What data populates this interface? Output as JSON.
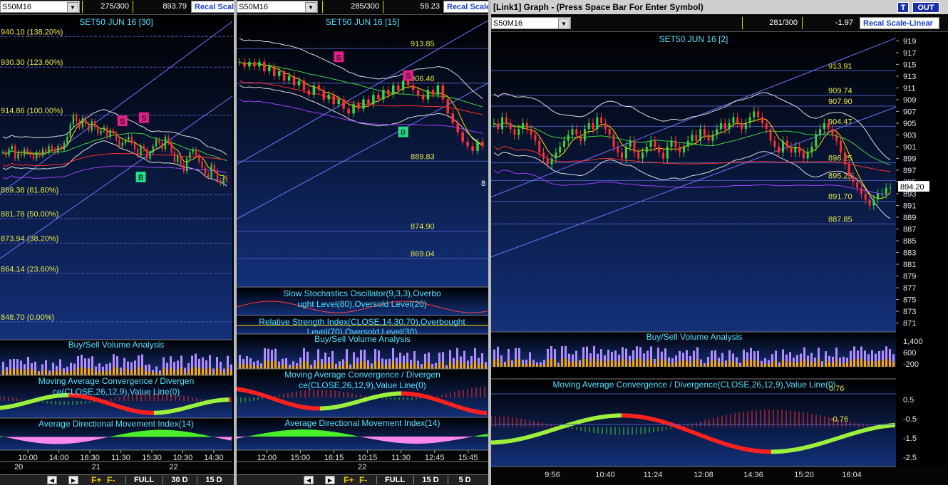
{
  "panels": [
    {
      "symbol": "S50M16",
      "count": "275/300",
      "value": "893.79",
      "recal": "Recal Scale",
      "bottom_buttons": [
        "FULL",
        "30 D",
        "15 D"
      ],
      "f_icons": [
        "F+",
        "F-"
      ]
    },
    {
      "symbol": "S50M16",
      "count": "285/300",
      "value": "59.23",
      "recal": "Recal Scale",
      "bottom_buttons": [
        "FULL",
        "15 D",
        "5 D"
      ],
      "f_icons": [
        "F+",
        "F-"
      ]
    },
    {
      "title": "[Link1] Graph  - (Press Space Bar For Enter Symbol)",
      "t_button": "T",
      "out_button": "OUT",
      "symbol": "S50M16",
      "count": "281/300",
      "value": "-1.97",
      "recal": "Recal Scale-Linear"
    }
  ],
  "colors": {
    "background": "#000000",
    "gridline": "#2d3a86",
    "label": "#e8e84a",
    "title": "#4fe0ff",
    "buy": "#ffa500",
    "sell": "#b38cff",
    "macd_pos": "#9cf03c",
    "macd_neg": "#ff2020",
    "adx_fill": "#ff88ee"
  },
  "chart_data": [
    {
      "type": "candlestick",
      "title": "SET50 JUN 16  [30]",
      "ylim": [
        843,
        947
      ],
      "fib_levels": [
        {
          "price": 940.1,
          "label": "940.10 (138.20%)"
        },
        {
          "price": 930.3,
          "label": "930.30 (123.60%)"
        },
        {
          "price": 914.86,
          "label": "914.86 (100.00%)"
        },
        {
          "price": 889.38,
          "label": "889.38 (61.80%)"
        },
        {
          "price": 881.78,
          "label": "881.78 (50.00%)"
        },
        {
          "price": 873.94,
          "label": "873.94 (38.20%)"
        },
        {
          "price": 864.14,
          "label": "864.14 (23.60%)"
        },
        {
          "price": 848.7,
          "label": "848.70 (0.00%)"
        }
      ],
      "close": [
        903,
        902,
        904,
        905,
        901,
        903,
        902,
        904,
        903,
        902,
        901,
        903,
        902,
        904,
        903,
        905,
        904,
        903,
        905,
        904,
        906,
        908,
        912,
        915,
        913,
        911,
        914,
        912,
        910,
        913,
        911,
        909,
        910,
        911,
        908,
        910,
        909,
        907,
        905,
        906,
        907,
        908,
        906,
        904,
        902,
        905,
        904,
        901,
        903,
        905,
        907,
        906,
        904,
        908,
        906,
        903,
        900,
        902,
        899,
        897,
        901,
        903,
        904,
        902,
        900,
        898,
        896,
        895,
        899,
        897,
        894,
        893,
        895,
        894
      ],
      "signals": [
        {
          "label": "S",
          "index": 39,
          "price": 913
        },
        {
          "label": "S",
          "index": 46,
          "price": 914
        },
        {
          "label": "B",
          "index": 45,
          "price": 895
        }
      ],
      "volume_title": "Buy/Sell Volume Analysis",
      "macd_title": "Moving Average Convergence / Divergence(CLOSE,26,12,9),Value Line(0)",
      "adx_title": "Average Directional Movement Index(14)",
      "x_ticks": [
        "10:00",
        "14:00",
        "16:30",
        "11:30",
        "15:30",
        "10:30",
        "14:30"
      ],
      "day_ticks": [
        "20",
        "21",
        "22"
      ]
    },
    {
      "type": "candlestick",
      "title": "SET50 JUN 16  [15]",
      "ylim": [
        863,
        921
      ],
      "levels": [
        {
          "price": 913.85,
          "label": "913.85"
        },
        {
          "price": 906.46,
          "label": "906.46"
        },
        {
          "price": 889.83,
          "label": "889.83"
        },
        {
          "price": 874.9,
          "label": "874.90"
        },
        {
          "price": 869.04,
          "label": "869.04"
        }
      ],
      "right_label": "8",
      "close": [
        911,
        910,
        911,
        910,
        911,
        909,
        910,
        908,
        909,
        907,
        908,
        906,
        907,
        905,
        904,
        906,
        905,
        903,
        904,
        902,
        903,
        901,
        900,
        902,
        901,
        903,
        902,
        904,
        903,
        905,
        904,
        906,
        905,
        907,
        906,
        905,
        904,
        903,
        905,
        904,
        906,
        903,
        900,
        898,
        896,
        894,
        893,
        892,
        894,
        893
      ],
      "signals": [
        {
          "label": "S",
          "index": 20,
          "price": 912
        },
        {
          "label": "S",
          "index": 34,
          "price": 908
        },
        {
          "label": "B",
          "index": 33,
          "price": 896
        }
      ],
      "stoch_title": "Slow Stochastics Oscillator(9,3,3),Overbought Level(80),Oversold Level(20)",
      "rsi_title": "Relative Strength Index(CLOSE,14,30,70),Overbought Level(70),Oversold Level(30)",
      "volume_title": "Buy/Sell Volume Analysis",
      "macd_title": "Moving Average Convergence / Divergence(CLOSE,26,12,9),Value Line(0)",
      "adx_title": "Average Directional Movement Index(14)",
      "x_ticks": [
        "12:00",
        "15:00",
        "16:15",
        "10:15",
        "11:30",
        "12:45",
        "15:45"
      ],
      "day_ticks": [
        "22"
      ]
    },
    {
      "type": "candlestick",
      "title": "SET50 JUN 16  [2]",
      "ylim": [
        869.5,
        920.5
      ],
      "levels": [
        {
          "price": 913.91,
          "label": "913.91"
        },
        {
          "price": 909.74,
          "label": "909.74"
        },
        {
          "price": 907.9,
          "label": "907.90"
        },
        {
          "price": 904.47,
          "label": "904.47"
        },
        {
          "price": 898.25,
          "label": "898.25"
        },
        {
          "price": 895.25,
          "label": "895.25"
        },
        {
          "price": 891.7,
          "label": "891.70"
        },
        {
          "price": 887.85,
          "label": "887.85"
        }
      ],
      "y_ticks": [
        919,
        917,
        915,
        913,
        911,
        909,
        907,
        905,
        903,
        901,
        899,
        897,
        895,
        893,
        891,
        889,
        887,
        885,
        883,
        881,
        879,
        877,
        875,
        873,
        871
      ],
      "last_price": "894.20",
      "close": [
        905,
        904,
        906,
        905,
        904,
        903,
        904,
        905,
        904,
        903,
        902,
        900,
        899,
        898,
        899,
        900,
        901,
        902,
        903,
        904,
        903,
        902,
        904,
        905,
        904,
        906,
        905,
        904,
        903,
        901,
        900,
        899,
        901,
        902,
        900,
        899,
        900,
        901,
        902,
        901,
        900,
        899,
        901,
        902,
        901,
        900,
        901,
        902,
        903,
        902,
        904,
        903,
        902,
        903,
        904,
        905,
        904,
        905,
        906,
        905,
        904,
        905,
        906,
        907,
        906,
        905,
        904,
        902,
        901,
        900,
        902,
        901,
        900,
        901,
        900,
        899,
        900,
        901,
        903,
        904,
        905,
        904,
        903,
        902,
        900,
        898,
        896,
        895,
        894,
        893,
        892,
        891,
        892,
        893,
        893,
        894,
        894
      ],
      "volume_title": "Buy/Sell Volume Analysis",
      "volume_ticks": [
        "1,400",
        "600",
        "-200"
      ],
      "macd_title": "Moving Average Convergence / Divergence(CLOSE,26,12,9),Value Line(0)",
      "macd_levels": [
        "0.76",
        "-0.76"
      ],
      "macd_ticks": [
        "0.5",
        "-0.5",
        "-1.5",
        "-2.5"
      ],
      "x_ticks": [
        "9:56",
        "10:40",
        "11:24",
        "12:08",
        "14:36",
        "15:20",
        "16:04"
      ]
    }
  ]
}
